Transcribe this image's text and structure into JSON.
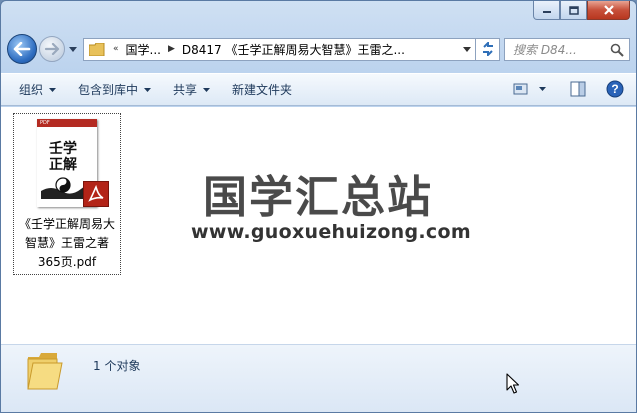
{
  "address": {
    "overflow": "«",
    "segments": [
      "国学...",
      "D8417 《壬学正解周易大智慧》王雷之..."
    ]
  },
  "search": {
    "placeholder": "搜索 D84..."
  },
  "toolbar": {
    "organize": "组织",
    "include_library": "包含到库中",
    "share": "共享",
    "new_folder": "新建文件夹"
  },
  "file": {
    "name_line1": "《壬学正解周易大",
    "name_line2": "智慧》王雷之著",
    "name_line3": "365页.pdf",
    "cover_tag": "PDF",
    "cover_title_1": "壬学",
    "cover_title_2": "正解"
  },
  "watermark": {
    "cn": "国学汇总站",
    "en": "www.guoxuehuizong.com"
  },
  "details": {
    "count": "1 个对象"
  },
  "icons": [
    "back-arrow-icon",
    "forward-arrow-icon",
    "folder-icon",
    "refresh-icon",
    "search-icon",
    "view-icon",
    "preview-pane-icon",
    "help-icon",
    "pdf-icon",
    "mouse-cursor-icon"
  ],
  "colors": {
    "accent": "#2d6cc0",
    "pdf_red": "#b32418",
    "close_red": "#c7503a"
  }
}
